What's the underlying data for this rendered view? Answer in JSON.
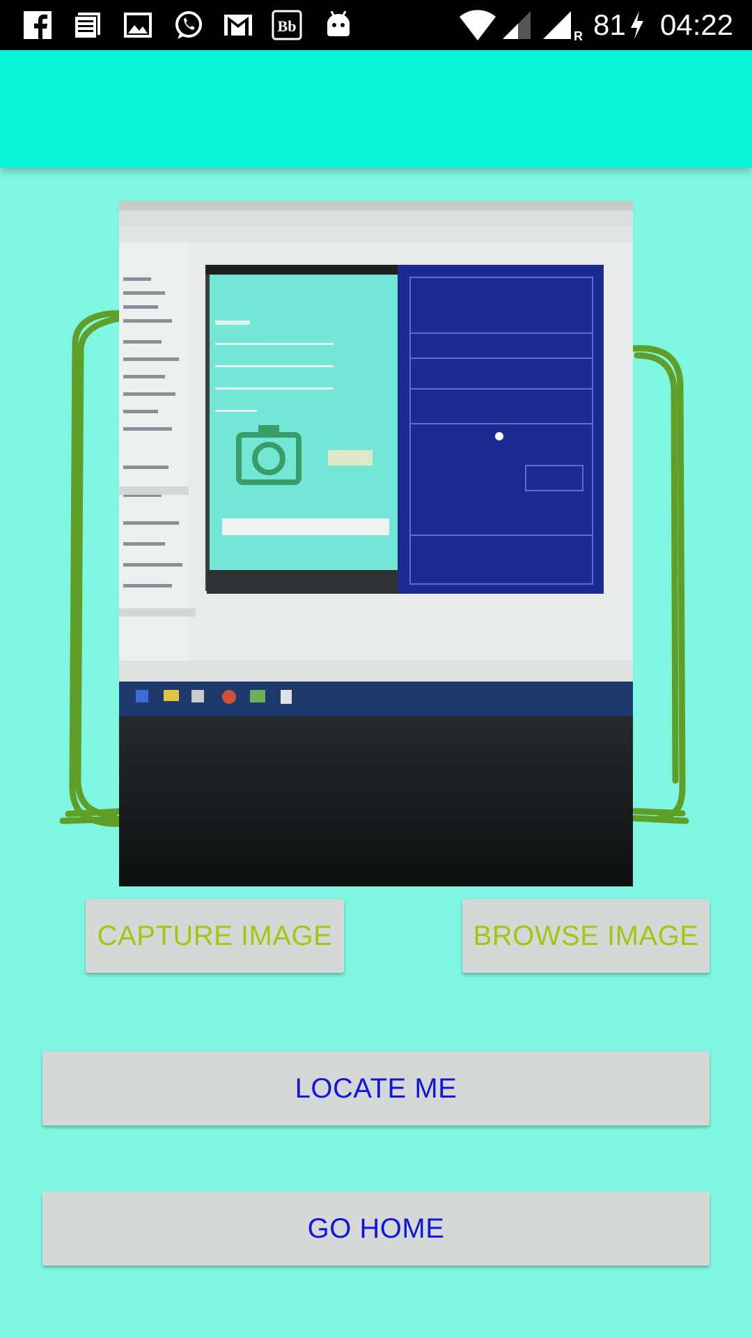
{
  "status_bar": {
    "battery": "81",
    "time": "04:22",
    "notification_icons": [
      "facebook-icon",
      "news-icon",
      "gallery-icon",
      "whatsapp-icon",
      "gmail-icon",
      "blackboard-icon",
      "android-icon"
    ],
    "system_icons": [
      "wifi-icon",
      "signal-icon",
      "signal-roaming-icon",
      "charging-icon"
    ]
  },
  "toolbar": {
    "background": "#0af5d8"
  },
  "screen": {
    "background": "#7ff7e0"
  },
  "image_preview": {
    "description_icon": "photo-of-monitor"
  },
  "actions": {
    "capture_label": "CAPTURE IMAGE",
    "browse_label": "BROWSE IMAGE",
    "locate_label": "LOCATE ME",
    "home_label": "GO HOME"
  },
  "colors": {
    "accent_green": "#a3c610",
    "accent_blue": "#1217d6",
    "button_bg": "#d6d7d7"
  }
}
